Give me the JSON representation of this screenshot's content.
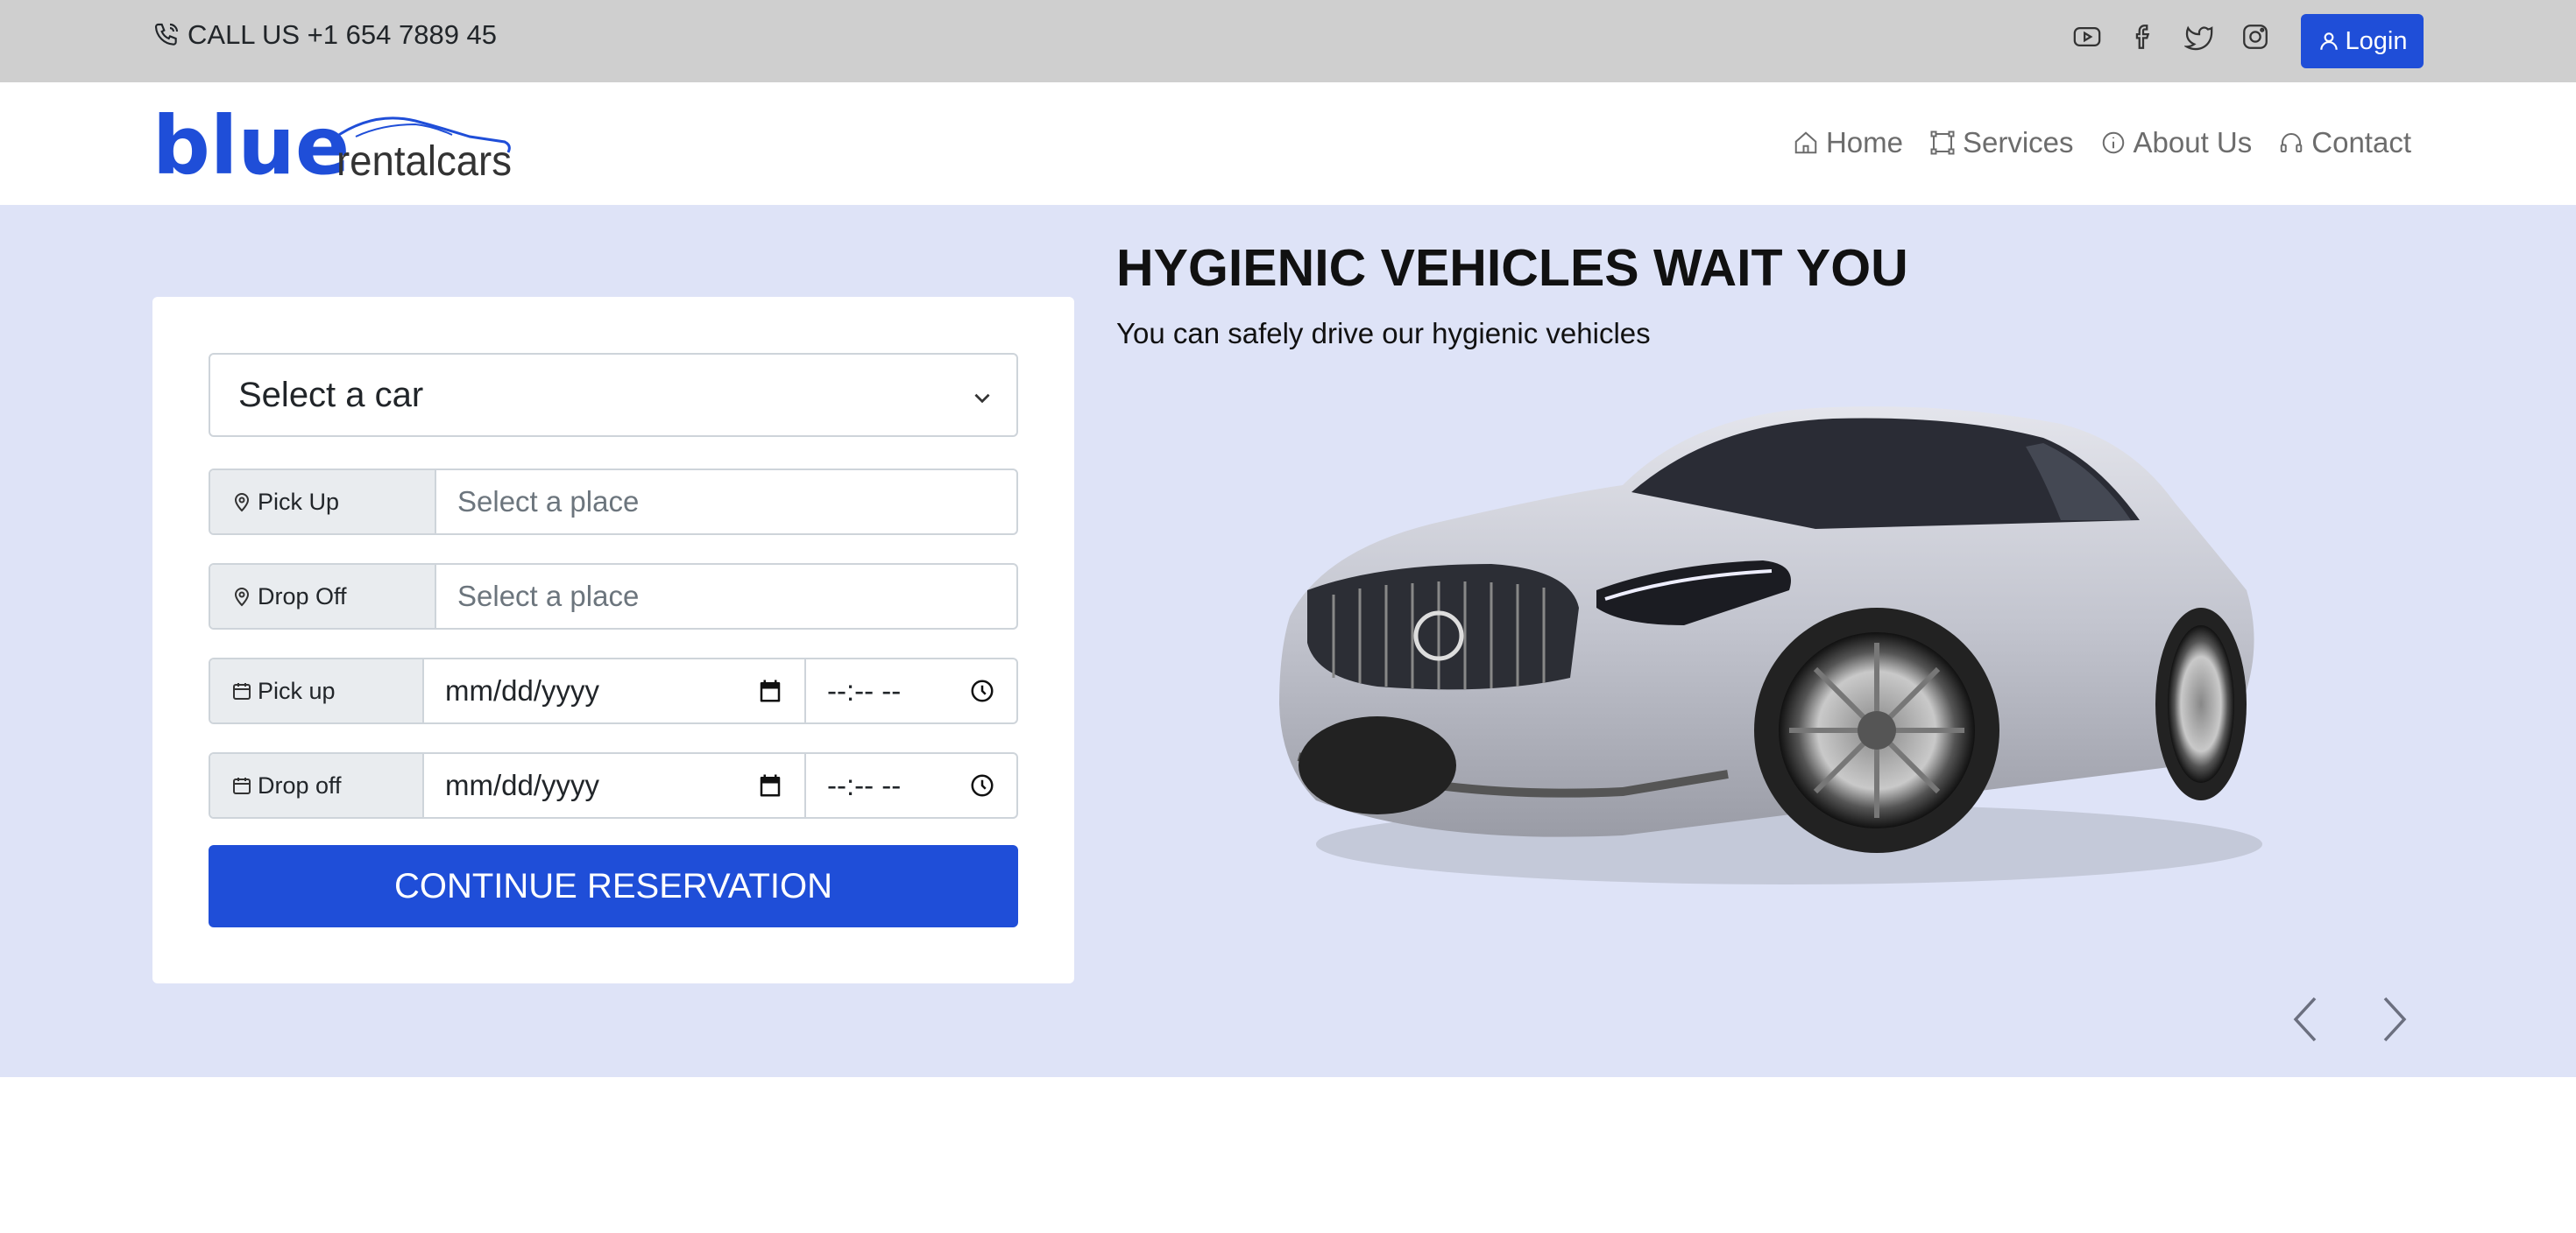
{
  "topbar": {
    "call_text": "CALL US +1 654 7889 45",
    "socials": [
      "youtube-icon",
      "facebook-icon",
      "twitter-icon",
      "instagram-icon"
    ],
    "login_label": "Login"
  },
  "brand": {
    "logo_main": "blue",
    "logo_sub": "rentalcars",
    "accent_color": "#1f4ed8"
  },
  "nav": {
    "items": [
      {
        "label": "Home",
        "icon": "home-icon"
      },
      {
        "label": "Services",
        "icon": "services-icon"
      },
      {
        "label": "About Us",
        "icon": "info-icon"
      },
      {
        "label": "Contact",
        "icon": "headset-icon"
      }
    ]
  },
  "form": {
    "car_select": "Select a car",
    "pickup": {
      "label": "Pick Up",
      "placeholder": "Select a place"
    },
    "dropoff": {
      "label": "Drop Off",
      "placeholder": "Select a place"
    },
    "pickup_dt": {
      "label": "Pick up",
      "date": "mm/dd/yyyy",
      "time": "--:-- --"
    },
    "dropoff_dt": {
      "label": "Drop off",
      "date": "mm/dd/yyyy",
      "time": "--:-- --"
    },
    "submit": "CONTINUE RESERVATION"
  },
  "hero": {
    "title": "HYGIENIC VEHICLES WAIT YOU",
    "subtitle": "You can safely drive our hygienic vehicles",
    "background": "#dee3f7"
  }
}
